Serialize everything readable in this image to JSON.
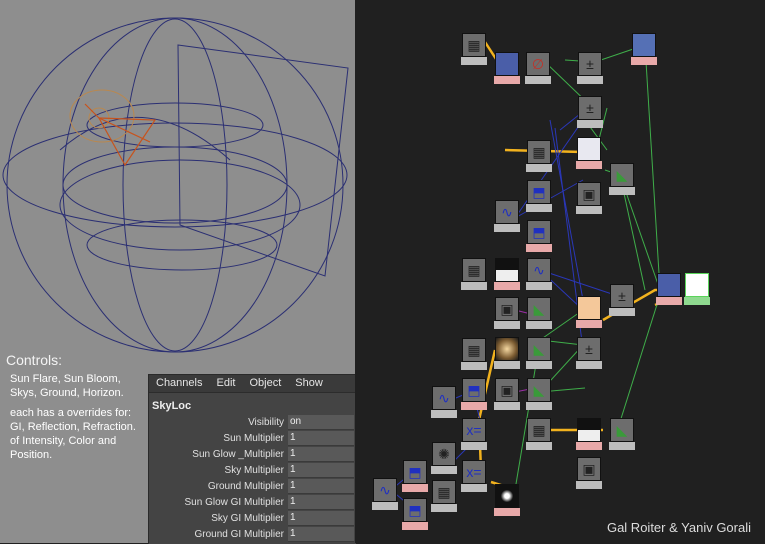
{
  "controls": {
    "title": "Controls:",
    "lines": [
      "Sun Flare, Sun Bloom,",
      "Skys, Ground, Horizon.",
      "each has a overrides for:",
      "GI, Reflection, Refraction.",
      "of Intensity, Color and",
      "Position."
    ]
  },
  "channel_box": {
    "menu": [
      "Channels",
      "Edit",
      "Object",
      "Show"
    ],
    "node_name": "SkyLoc",
    "attributes": [
      {
        "label": "Visibility",
        "value": "on"
      },
      {
        "label": "Sun Multiplier",
        "value": "1"
      },
      {
        "label": "Sun Glow _Multiplier",
        "value": "1"
      },
      {
        "label": "Sky Multiplier",
        "value": "1"
      },
      {
        "label": "Ground Multiplier",
        "value": "1"
      },
      {
        "label": "Sun Glow GI Multiplier",
        "value": "1"
      },
      {
        "label": "Sky GI Multiplier",
        "value": "1"
      },
      {
        "label": "Ground GI Multiplier",
        "value": "1"
      }
    ]
  },
  "credit": "Gal Roiter & Yaniv Gorali",
  "colors": {
    "viewport_bg": "#8e8e8e",
    "wire": "#2b2f73",
    "light_wire": "#c8531c",
    "graph_bg": "#202020",
    "conn_yellow": "#f2b21e",
    "conn_green": "#3fae4a",
    "conn_blue": "#2a37b8"
  }
}
